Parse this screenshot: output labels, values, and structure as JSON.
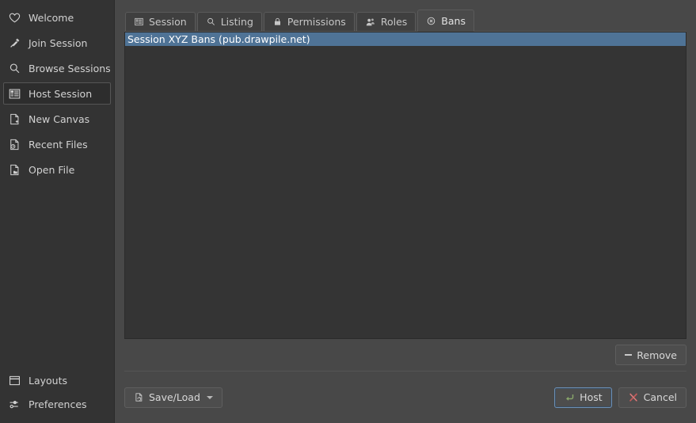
{
  "colors": {
    "sidebar_bg": "#333333",
    "dialog_bg": "#484848",
    "list_bg": "#343434",
    "selection": "#4f7396",
    "tab_active_bg": "#4a4a4a",
    "focus_border": "#6d90b5",
    "host_icon": "#8aa86a",
    "cancel_icon": "#c05a5a"
  },
  "sidebar": {
    "items": [
      {
        "label": "Welcome",
        "icon": "heart-icon",
        "selected": false
      },
      {
        "label": "Join Session",
        "icon": "plug-icon",
        "selected": false
      },
      {
        "label": "Browse Sessions",
        "icon": "magnifier-icon",
        "selected": false
      },
      {
        "label": "Host Session",
        "icon": "server-list-icon",
        "selected": true
      },
      {
        "label": "New Canvas",
        "icon": "document-plus-icon",
        "selected": false
      },
      {
        "label": "Recent Files",
        "icon": "document-clock-icon",
        "selected": false
      },
      {
        "label": "Open File",
        "icon": "document-folder-icon",
        "selected": false
      }
    ],
    "bottom_items": [
      {
        "label": "Layouts",
        "icon": "window-layout-icon"
      },
      {
        "label": "Preferences",
        "icon": "sliders-icon"
      }
    ]
  },
  "dialog": {
    "tabs": [
      {
        "label": "Session",
        "icon": "list-lines-icon",
        "active": false
      },
      {
        "label": "Listing",
        "icon": "magnifier-icon",
        "active": false
      },
      {
        "label": "Permissions",
        "icon": "lock-icon",
        "active": false
      },
      {
        "label": "Roles",
        "icon": "people-icon",
        "active": false
      },
      {
        "label": "Bans",
        "icon": "circle-x-icon",
        "active": true
      }
    ],
    "ban_list": [
      {
        "text": "Session XYZ Bans (pub.drawpile.net)",
        "selected": true
      }
    ],
    "remove_button": {
      "label": "Remove",
      "icon": "minus-icon"
    },
    "save_load_button": {
      "label": "Save/Load",
      "icon": "document-arrow-icon",
      "has_dropdown": true
    },
    "host_button": {
      "label": "Host",
      "icon": "enter-arrow-icon",
      "focused": true
    },
    "cancel_button": {
      "label": "Cancel",
      "icon": "x-mark-icon",
      "focused": false
    }
  }
}
